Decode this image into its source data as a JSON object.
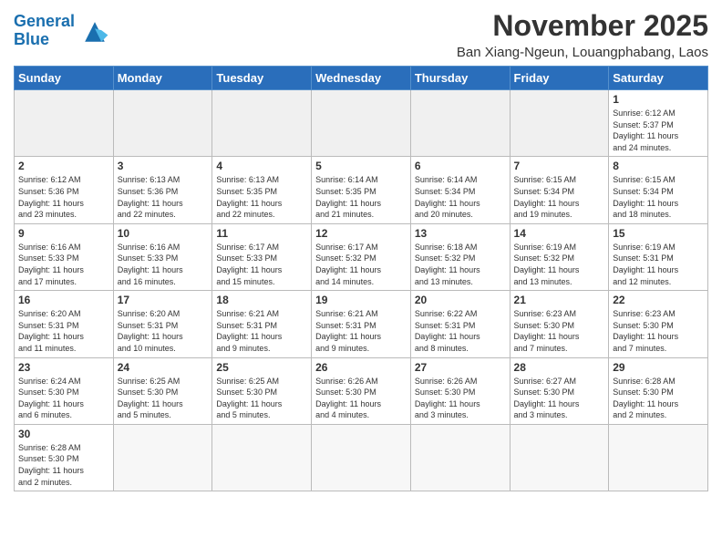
{
  "header": {
    "logo_line1": "General",
    "logo_line2": "Blue",
    "month_year": "November 2025",
    "location": "Ban Xiang-Ngeun, Louangphabang, Laos"
  },
  "weekdays": [
    "Sunday",
    "Monday",
    "Tuesday",
    "Wednesday",
    "Thursday",
    "Friday",
    "Saturday"
  ],
  "days": [
    {
      "date": "",
      "info": ""
    },
    {
      "date": "",
      "info": ""
    },
    {
      "date": "",
      "info": ""
    },
    {
      "date": "",
      "info": ""
    },
    {
      "date": "",
      "info": ""
    },
    {
      "date": "",
      "info": ""
    },
    {
      "date": "1",
      "info": "Sunrise: 6:12 AM\nSunset: 5:37 PM\nDaylight: 11 hours\nand 24 minutes."
    },
    {
      "date": "2",
      "info": "Sunrise: 6:12 AM\nSunset: 5:36 PM\nDaylight: 11 hours\nand 23 minutes."
    },
    {
      "date": "3",
      "info": "Sunrise: 6:13 AM\nSunset: 5:36 PM\nDaylight: 11 hours\nand 22 minutes."
    },
    {
      "date": "4",
      "info": "Sunrise: 6:13 AM\nSunset: 5:35 PM\nDaylight: 11 hours\nand 22 minutes."
    },
    {
      "date": "5",
      "info": "Sunrise: 6:14 AM\nSunset: 5:35 PM\nDaylight: 11 hours\nand 21 minutes."
    },
    {
      "date": "6",
      "info": "Sunrise: 6:14 AM\nSunset: 5:34 PM\nDaylight: 11 hours\nand 20 minutes."
    },
    {
      "date": "7",
      "info": "Sunrise: 6:15 AM\nSunset: 5:34 PM\nDaylight: 11 hours\nand 19 minutes."
    },
    {
      "date": "8",
      "info": "Sunrise: 6:15 AM\nSunset: 5:34 PM\nDaylight: 11 hours\nand 18 minutes."
    },
    {
      "date": "9",
      "info": "Sunrise: 6:16 AM\nSunset: 5:33 PM\nDaylight: 11 hours\nand 17 minutes."
    },
    {
      "date": "10",
      "info": "Sunrise: 6:16 AM\nSunset: 5:33 PM\nDaylight: 11 hours\nand 16 minutes."
    },
    {
      "date": "11",
      "info": "Sunrise: 6:17 AM\nSunset: 5:33 PM\nDaylight: 11 hours\nand 15 minutes."
    },
    {
      "date": "12",
      "info": "Sunrise: 6:17 AM\nSunset: 5:32 PM\nDaylight: 11 hours\nand 14 minutes."
    },
    {
      "date": "13",
      "info": "Sunrise: 6:18 AM\nSunset: 5:32 PM\nDaylight: 11 hours\nand 13 minutes."
    },
    {
      "date": "14",
      "info": "Sunrise: 6:19 AM\nSunset: 5:32 PM\nDaylight: 11 hours\nand 13 minutes."
    },
    {
      "date": "15",
      "info": "Sunrise: 6:19 AM\nSunset: 5:31 PM\nDaylight: 11 hours\nand 12 minutes."
    },
    {
      "date": "16",
      "info": "Sunrise: 6:20 AM\nSunset: 5:31 PM\nDaylight: 11 hours\nand 11 minutes."
    },
    {
      "date": "17",
      "info": "Sunrise: 6:20 AM\nSunset: 5:31 PM\nDaylight: 11 hours\nand 10 minutes."
    },
    {
      "date": "18",
      "info": "Sunrise: 6:21 AM\nSunset: 5:31 PM\nDaylight: 11 hours\nand 9 minutes."
    },
    {
      "date": "19",
      "info": "Sunrise: 6:21 AM\nSunset: 5:31 PM\nDaylight: 11 hours\nand 9 minutes."
    },
    {
      "date": "20",
      "info": "Sunrise: 6:22 AM\nSunset: 5:31 PM\nDaylight: 11 hours\nand 8 minutes."
    },
    {
      "date": "21",
      "info": "Sunrise: 6:23 AM\nSunset: 5:30 PM\nDaylight: 11 hours\nand 7 minutes."
    },
    {
      "date": "22",
      "info": "Sunrise: 6:23 AM\nSunset: 5:30 PM\nDaylight: 11 hours\nand 7 minutes."
    },
    {
      "date": "23",
      "info": "Sunrise: 6:24 AM\nSunset: 5:30 PM\nDaylight: 11 hours\nand 6 minutes."
    },
    {
      "date": "24",
      "info": "Sunrise: 6:25 AM\nSunset: 5:30 PM\nDaylight: 11 hours\nand 5 minutes."
    },
    {
      "date": "25",
      "info": "Sunrise: 6:25 AM\nSunset: 5:30 PM\nDaylight: 11 hours\nand 5 minutes."
    },
    {
      "date": "26",
      "info": "Sunrise: 6:26 AM\nSunset: 5:30 PM\nDaylight: 11 hours\nand 4 minutes."
    },
    {
      "date": "27",
      "info": "Sunrise: 6:26 AM\nSunset: 5:30 PM\nDaylight: 11 hours\nand 3 minutes."
    },
    {
      "date": "28",
      "info": "Sunrise: 6:27 AM\nSunset: 5:30 PM\nDaylight: 11 hours\nand 3 minutes."
    },
    {
      "date": "29",
      "info": "Sunrise: 6:28 AM\nSunset: 5:30 PM\nDaylight: 11 hours\nand 2 minutes."
    },
    {
      "date": "30",
      "info": "Sunrise: 6:28 AM\nSunset: 5:30 PM\nDaylight: 11 hours\nand 2 minutes."
    },
    {
      "date": "",
      "info": ""
    },
    {
      "date": "",
      "info": ""
    },
    {
      "date": "",
      "info": ""
    },
    {
      "date": "",
      "info": ""
    },
    {
      "date": "",
      "info": ""
    },
    {
      "date": "",
      "info": ""
    }
  ]
}
